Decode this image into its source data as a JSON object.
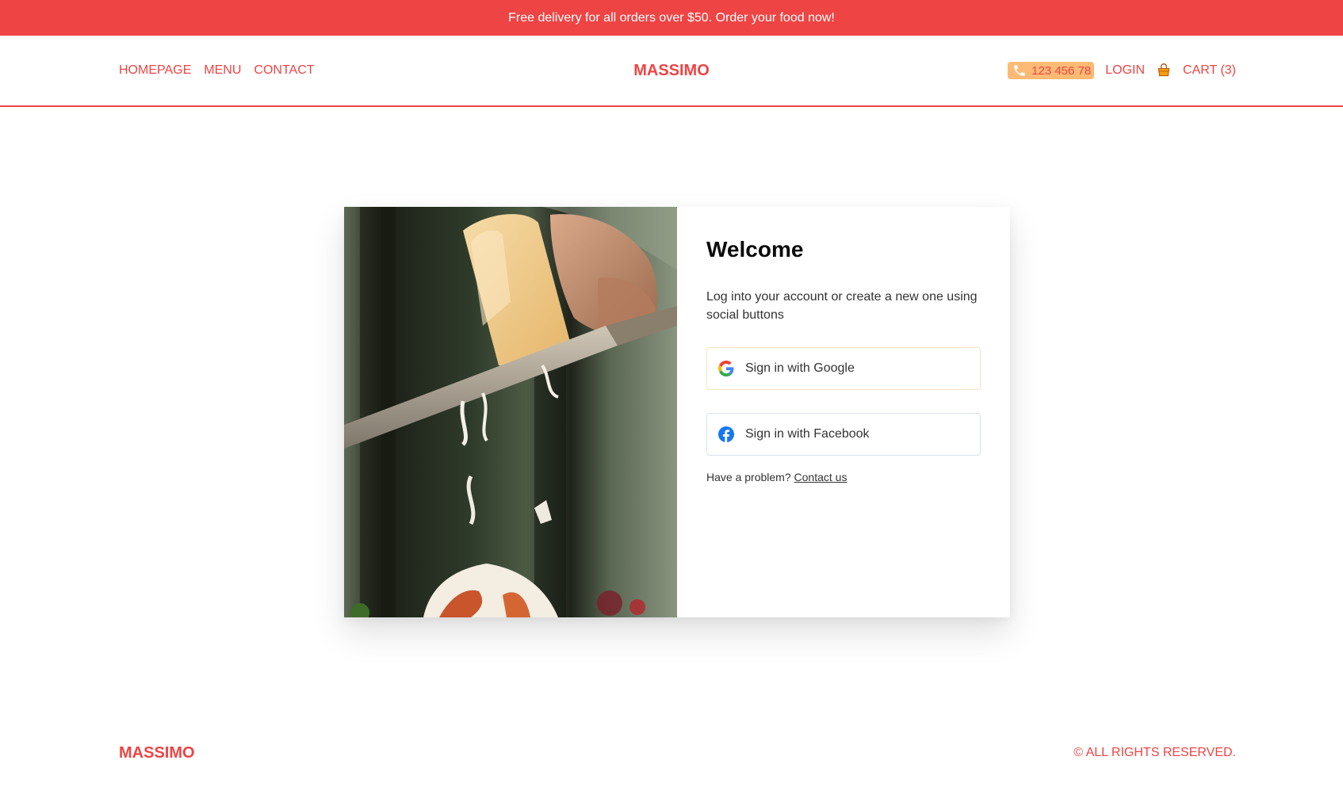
{
  "banner": {
    "text": "Free delivery for all orders over $50. Order your food now!"
  },
  "nav": {
    "links": [
      "HOMEPAGE",
      "MENU",
      "CONTACT"
    ],
    "logo": "MASSIMO",
    "phone": "123 456 78",
    "login": "LOGIN",
    "cart": "CART (3)"
  },
  "login_card": {
    "title": "Welcome",
    "description": "Log into your account or create a new one using social buttons",
    "google_button": "Sign in with Google",
    "facebook_button": "Sign in with Facebook",
    "problem_text": "Have a problem?",
    "contact_link": "Contact us"
  },
  "footer": {
    "logo": "MASSIMO",
    "copyright": "© ALL RIGHTS RESERVED."
  },
  "colors": {
    "accent": "#ef4444",
    "phone_badge": "#fdba74",
    "facebook": "#1877f2"
  },
  "icons": {
    "phone": "phone-icon",
    "cart": "cart-icon",
    "google": "google-icon",
    "facebook": "facebook-icon"
  }
}
